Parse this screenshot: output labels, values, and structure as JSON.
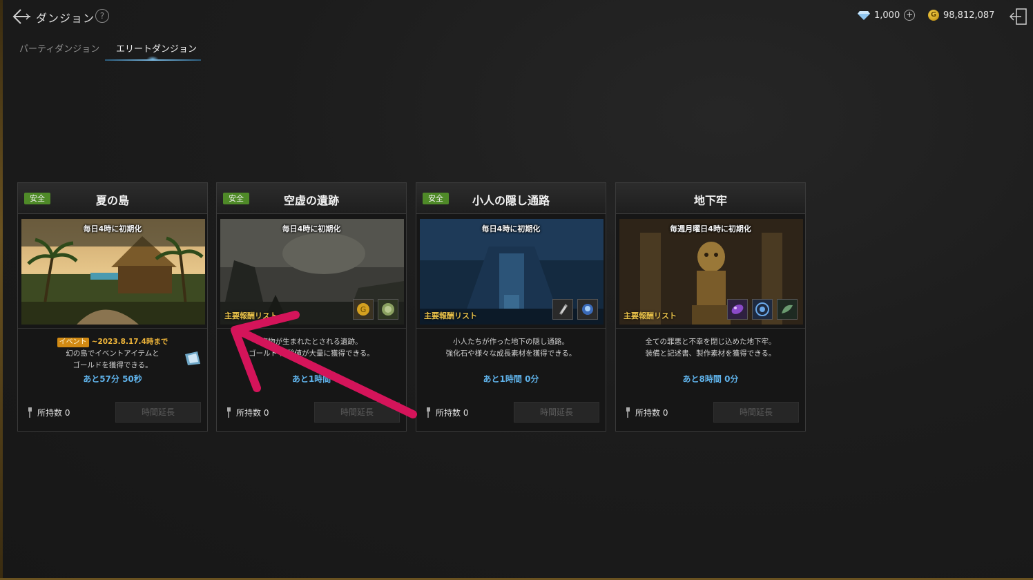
{
  "header": {
    "title": "ダンジョン",
    "help": "?",
    "gems": "1,000",
    "plus": "+",
    "gold_symbol": "G",
    "gold": "98,812,087"
  },
  "tabs": [
    {
      "label": "パーティダンジョン",
      "active": false
    },
    {
      "label": "エリートダンジョン",
      "active": true
    }
  ],
  "cards": [
    {
      "badge": "安全",
      "title": "夏の島",
      "reset": "毎日4時に初期化",
      "event_tag": "イベント",
      "event_date": "~2023.8.17.4時まで",
      "desc1": "幻の島でイベントアイテムと",
      "desc2": "ゴールドを獲得できる。",
      "remaining": "あと57分 50秒",
      "owned": "所持数 0",
      "button": "時間延長"
    },
    {
      "badge": "安全",
      "title": "空虚の遺跡",
      "reset": "毎日4時に初期化",
      "reward_label": "主要報酬リスト",
      "desc1": "魔物が生まれたとされる遺跡。",
      "desc2": "ゴールド 経験値が大量に獲得できる。",
      "remaining": "あと1時間",
      "owned": "所持数 0",
      "button": "時間延長"
    },
    {
      "badge": "安全",
      "title": "小人の隠し通路",
      "reset": "毎日4時に初期化",
      "reward_label": "主要報酬リスト",
      "desc1": "小人たちが作った地下の隠し通路。",
      "desc2": "強化石や様々な成長素材を獲得できる。",
      "remaining": "あと1時間 0分",
      "owned": "所持数 0",
      "button": "時間延長"
    },
    {
      "badge": "",
      "title": "地下牢",
      "reset": "毎週月曜日4時に初期化",
      "reward_label": "主要報酬リスト",
      "desc1": "全ての罪悪と不幸を閉じ込めた地下牢。",
      "desc2": "装備と記述書、製作素材を獲得できる。",
      "remaining": "あと8時間 0分",
      "owned": "所持数 0",
      "button": "時間延長"
    }
  ],
  "colors": {
    "safe_badge": "#4f8a28",
    "event_tag": "#d18a14",
    "remaining_text": "#5fb2ea",
    "reward_label": "#e8c14a",
    "annotation_arrow": "#d4145a"
  }
}
